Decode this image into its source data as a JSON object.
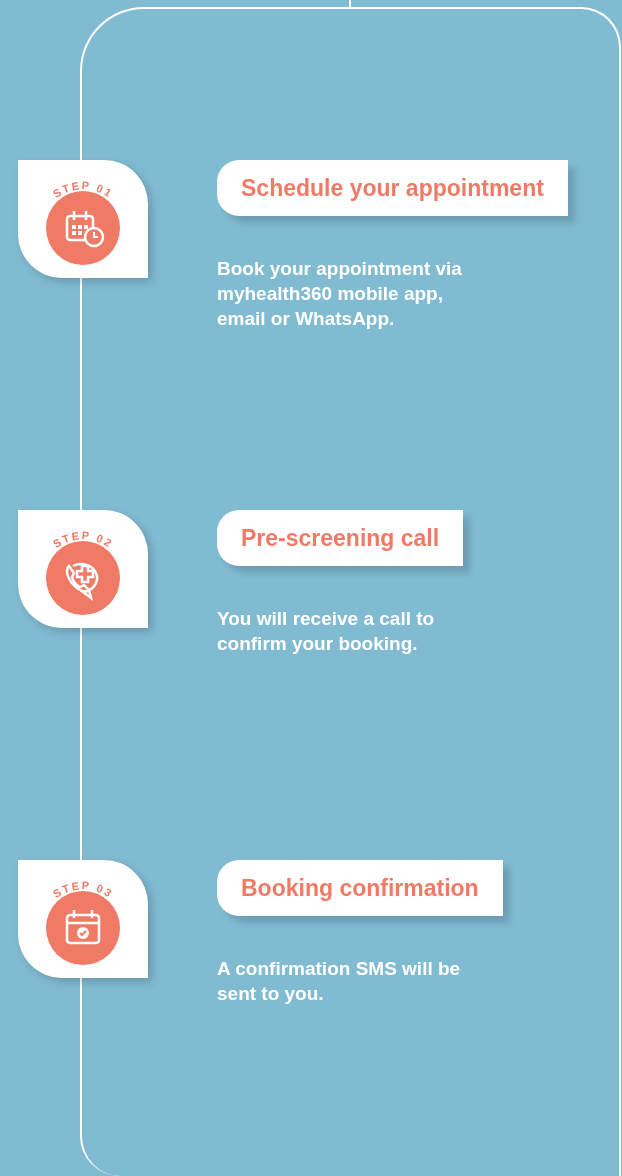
{
  "steps": [
    {
      "step_label": "STEP 01",
      "kind": "calendar-clock",
      "title": "Schedule your appointment",
      "description": "Book your appointment via myhealth360 mobile app, email or WhatsApp."
    },
    {
      "step_label": "STEP 02",
      "kind": "phone-plus",
      "title": "Pre-screening call",
      "description": "You will receive a call to confirm your booking."
    },
    {
      "step_label": "STEP 03",
      "kind": "calendar-check",
      "title": "Booking confirmation",
      "description": "A confirmation SMS will be sent to you."
    }
  ]
}
